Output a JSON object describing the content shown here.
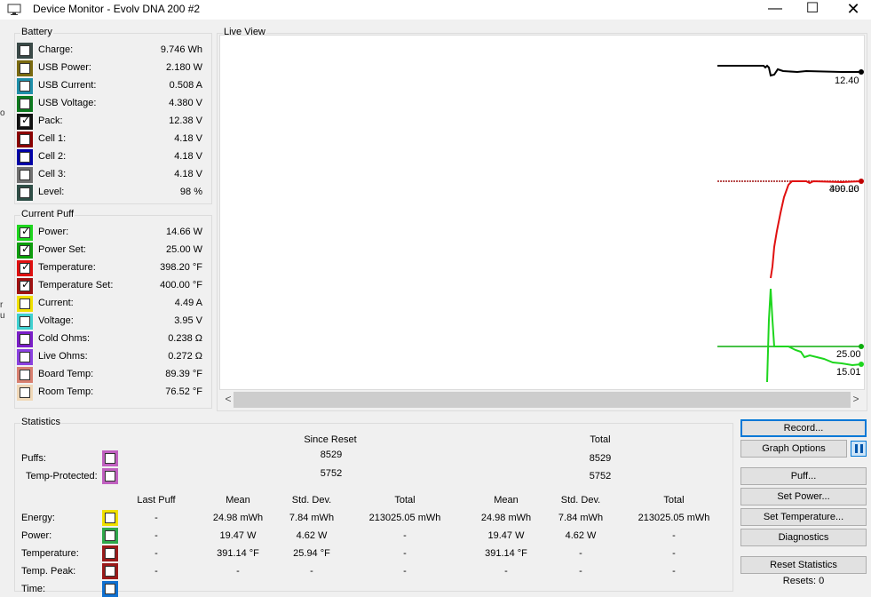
{
  "window": {
    "title": "Device Monitor - Evolv DNA 200 #2",
    "min_glyph": "—",
    "max_glyph": "☐",
    "close_glyph": "✕"
  },
  "battery": {
    "title": "Battery",
    "items": [
      {
        "label": "Charge:",
        "value": "9.746 Wh",
        "color": "#3a4a48",
        "checked": false
      },
      {
        "label": "USB Power:",
        "value": "2.180 W",
        "color": "#7a6a10",
        "checked": false
      },
      {
        "label": "USB Current:",
        "value": "0.508 A",
        "color": "#1e8ea8",
        "checked": false
      },
      {
        "label": "USB Voltage:",
        "value": "4.380 V",
        "color": "#0c7a1e",
        "checked": false
      },
      {
        "label": "Pack:",
        "value": "12.38 V",
        "color": "#111111",
        "checked": true
      },
      {
        "label": "Cell 1:",
        "value": "4.18 V",
        "color": "#8b0000",
        "checked": false
      },
      {
        "label": "Cell 2:",
        "value": "4.18 V",
        "color": "#0000a8",
        "checked": false
      },
      {
        "label": "Cell 3:",
        "value": "4.18 V",
        "color": "#707070",
        "checked": false
      },
      {
        "label": "Level:",
        "value": "98 %",
        "color": "#2e4e46",
        "checked": false
      }
    ]
  },
  "current_puff": {
    "title": "Current Puff",
    "items": [
      {
        "label": "Power:",
        "value": "14.66 W",
        "color": "#1ed61e",
        "checked": true
      },
      {
        "label": "Power Set:",
        "value": "25.00 W",
        "color": "#0c9e0c",
        "checked": true
      },
      {
        "label": "Temperature:",
        "value": "398.20 °F",
        "color": "#e01010",
        "checked": true
      },
      {
        "label": "Temperature Set:",
        "value": "400.00 °F",
        "color": "#a01010",
        "checked": true
      },
      {
        "label": "Current:",
        "value": "4.49 A",
        "color": "#f0e000",
        "checked": false
      },
      {
        "label": "Voltage:",
        "value": "3.95 V",
        "color": "#40d0d0",
        "checked": false
      },
      {
        "label": "Cold Ohms:",
        "value": "0.238 Ω",
        "color": "#7a1ec8",
        "checked": false
      },
      {
        "label": "Live Ohms:",
        "value": "0.272 Ω",
        "color": "#8a40e0",
        "checked": false
      },
      {
        "label": "Board Temp:",
        "value": "89.39 °F",
        "color": "#d88070",
        "checked": false
      },
      {
        "label": "Room Temp:",
        "value": "76.52 °F",
        "color": "#f0d8b8",
        "checked": false
      }
    ]
  },
  "live_view": {
    "title": "Live View",
    "labels": {
      "pack": "12.40",
      "temp_a": "400.00",
      "temp_b": "399.26",
      "power_set": "25.00",
      "power": "15.01"
    },
    "scroll_left": "<",
    "scroll_right": ">"
  },
  "statistics": {
    "title": "Statistics",
    "since_reset": "Since Reset",
    "total": "Total",
    "puffs_label": "Puffs:",
    "temp_protected_label": "Temp-Protected:",
    "puffs_since": "8529",
    "puffs_total": "8529",
    "tp_since": "5752",
    "tp_total": "5752",
    "headers": {
      "last_puff": "Last Puff",
      "mean": "Mean",
      "std": "Std. Dev.",
      "total": "Total",
      "mean2": "Mean",
      "std2": "Std. Dev.",
      "total2": "Total"
    },
    "rows": [
      {
        "label": "Energy:",
        "color": "#f0e000",
        "last": "-",
        "mean": "24.98 mWh",
        "std": "7.84 mWh",
        "total": "213025.05 mWh",
        "mean2": "24.98 mWh",
        "std2": "7.84 mWh",
        "total2": "213025.05 mWh"
      },
      {
        "label": "Power:",
        "color": "#2ea84a",
        "last": "-",
        "mean": "19.47 W",
        "std": "4.62 W",
        "total": "-",
        "mean2": "19.47 W",
        "std2": "4.62 W",
        "total2": "-"
      },
      {
        "label": "Temperature:",
        "color": "#9a1a1a",
        "last": "-",
        "mean": "391.14 °F",
        "std": "25.94 °F",
        "total": "-",
        "mean2": "391.14 °F",
        "std2": "-",
        "total2": "-"
      },
      {
        "label": "Temp. Peak:",
        "color": "#9a1a1a",
        "last": "-",
        "mean": "-",
        "std": "-",
        "total": "-",
        "mean2": "-",
        "std2": "-",
        "total2": "-"
      },
      {
        "label": "Time:",
        "color": "#1070d0",
        "last": "",
        "mean": "",
        "std": "",
        "total": "",
        "mean2": "",
        "std2": "",
        "total2": ""
      }
    ],
    "puffs_color": "#c060c0",
    "tp_color": "#c060c0"
  },
  "buttons": {
    "record": "Record...",
    "graph_options": "Graph Options",
    "puff": "Puff...",
    "set_power": "Set Power...",
    "set_temperature": "Set Temperature...",
    "diagnostics": "Diagnostics",
    "reset_statistics": "Reset Statistics",
    "resets": "Resets: 0"
  },
  "edge": {
    "a": "o",
    "b": "r",
    "c": "u"
  }
}
